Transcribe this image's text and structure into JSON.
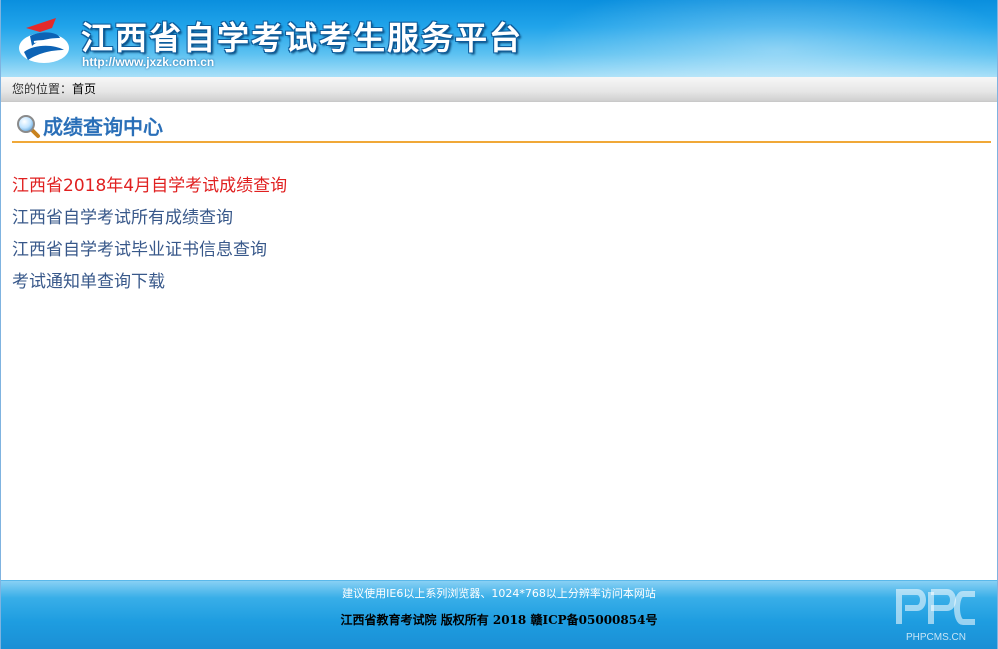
{
  "header": {
    "title": "江西省自学考试考生服务平台",
    "url": "http://www.jxzk.com.cn",
    "logo_icon": "jxzk-logo-icon"
  },
  "breadcrumb": {
    "prefix": "您的位置：",
    "home": "首页"
  },
  "section": {
    "icon": "magnifier-icon",
    "title": "成绩查询中心",
    "accent_color": "#f0a838",
    "title_color": "#2a6fb8"
  },
  "links": [
    {
      "label": "江西省2018年4月自学考试成绩查询",
      "color": "#e02020"
    },
    {
      "label": "江西省自学考试所有成绩查询",
      "color": "#38588a"
    },
    {
      "label": "江西省自学考试毕业证书信息查询",
      "color": "#38588a"
    },
    {
      "label": "考试通知单查询下载",
      "color": "#38588a"
    }
  ],
  "footer": {
    "notice": "建议使用IE6以上系列浏览器、1024*768以上分辨率访问本网站",
    "copyright": "江西省教育考试院 版权所有 2018 赣ICP备05000854号",
    "watermark": "PHPCMS.CN"
  }
}
